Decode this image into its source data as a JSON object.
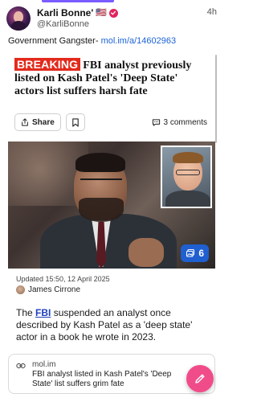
{
  "post": {
    "author_name": "Karli Bonne'",
    "author_flag": "🇺🇸",
    "author_handle": "@KarliBonne",
    "time": "4h",
    "text_prefix": "Government Gangster- ",
    "text_link": "mol.im/a/14602963"
  },
  "article": {
    "breaking_label": "BREAKING",
    "headline": "FBI analyst previously listed on Kash Patel's 'Deep State' actors list suffers harsh fate",
    "share_label": "Share",
    "comments_label": "3 comments",
    "gallery_count": "6",
    "updated": "Updated 15:50, 12 April 2025",
    "author": "James Cirrone",
    "lead_prefix": "The ",
    "lead_link": "FBI",
    "lead_rest": " suspended an analyst once described by Kash Patel as a 'deep state' actor in a book he wrote in 2023."
  },
  "link_card": {
    "domain": "mol.im",
    "title": "FBI analyst listed in Kash Patel's 'Deep State' list suffers grim fate"
  },
  "icons": {
    "verified": "verified-badge-icon",
    "share": "share-icon",
    "bookmark": "bookmark-icon",
    "comments": "comment-icon",
    "gallery": "gallery-icon",
    "link": "link-icon",
    "compose": "compose-icon"
  },
  "colors": {
    "breaking_bg": "#e22a1c",
    "link": "#1d63d6",
    "gallery_badge": "#1f5fcf",
    "fab": "#f04c8a",
    "verified": "#e0245e"
  }
}
